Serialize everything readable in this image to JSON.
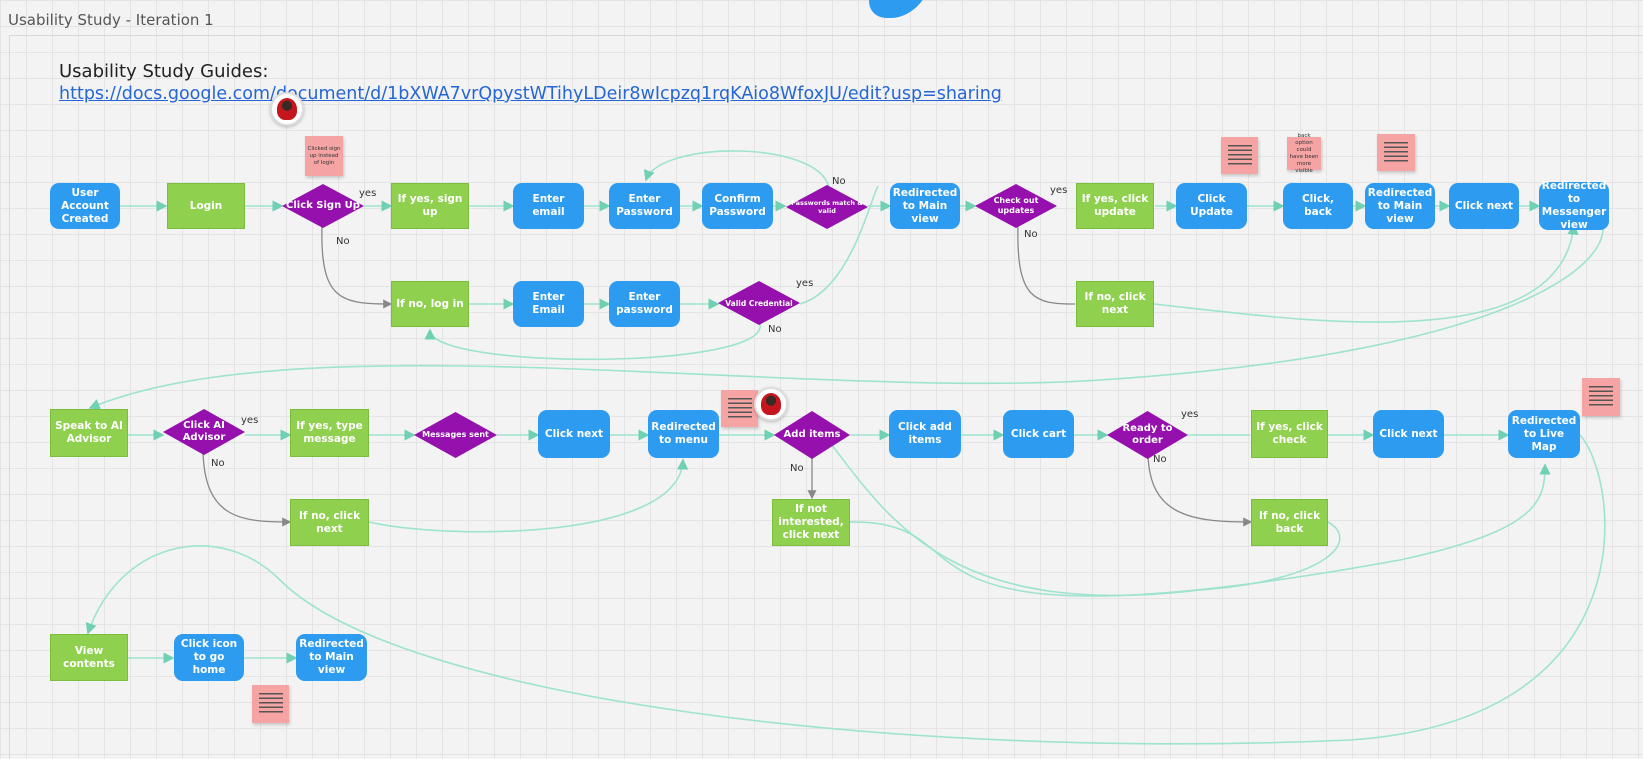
{
  "board": {
    "title": "Usability Study - Iteration 1",
    "guides_label": "Usability Study Guides:",
    "guides_link": "https://docs.google.com/document/d/1bXWA7vrQpystWTihyLDeir8wIcpzq1rqKAio8WfoxJU/edit?usp=sharing"
  },
  "colors": {
    "blue_node": "#2d9bf0",
    "green_node": "#8fd14f",
    "decision": "#9510ac",
    "connector": "#9ee3cf",
    "connector_gray": "#888888",
    "sticky": "#f5a3a3",
    "link": "#2566d6"
  },
  "nodes": {
    "user_account_created": "User Account Created",
    "login": "Login",
    "click_sign_up": "Click Sign Up",
    "if_yes_sign_up": "If yes, sign up",
    "enter_email": "Enter email",
    "enter_password": "Enter Password",
    "confirm_password": "Confirm Password",
    "passwords_match": "Passwords match & valid",
    "redirected_main_1": "Redirected to Main view",
    "check_out_updates": "Check out updates",
    "if_yes_click_update": "If yes, click update",
    "click_update": "Click Update",
    "click_back": "Click, back",
    "redirected_main_2": "Redirected to Main view",
    "click_next_1": "Click next",
    "redirected_messenger": "Redirected to Messenger view",
    "if_no_log_in": "If no, log in",
    "enter_email_2": "Enter Email",
    "enter_password_2": "Enter password",
    "valid_credential": "Valid Credential",
    "if_no_click_next_1": "If no, click next",
    "speak_to_ai": "Speak to AI Advisor",
    "click_ai_advisor": "Click AI Advisor",
    "if_yes_type_message": "If yes, type message",
    "messages_sent": "Messages sent",
    "click_next_2": "Click next",
    "redirected_menu": "Redirected to menu",
    "add_items": "Add items",
    "click_add_items": "Click add items",
    "click_cart": "Click cart",
    "ready_to_order": "Ready to order",
    "if_yes_click_check": "If yes, click check",
    "click_next_3": "Click next",
    "redirected_live_map": "Redirected to Live Map",
    "if_no_click_next_2": "If no, click next",
    "if_not_interested": "If not interested, click next",
    "if_no_click_back": "If no, click back",
    "view_contents": "View contents",
    "click_icon_home": "Click icon to go home",
    "redirected_main_3": "Redirected to Main view"
  },
  "edge_labels": {
    "signup_yes": "yes",
    "signup_no": "No",
    "passwords_no": "No",
    "updates_yes": "yes",
    "updates_no": "No",
    "credential_yes": "yes",
    "credential_no": "No",
    "ai_yes": "yes",
    "ai_no": "No",
    "add_no": "No",
    "order_yes": "yes",
    "order_no": "No"
  },
  "stickies": {
    "note_signup": "Clicked sign up instead of login",
    "note_back": "back option could have been more visible"
  }
}
